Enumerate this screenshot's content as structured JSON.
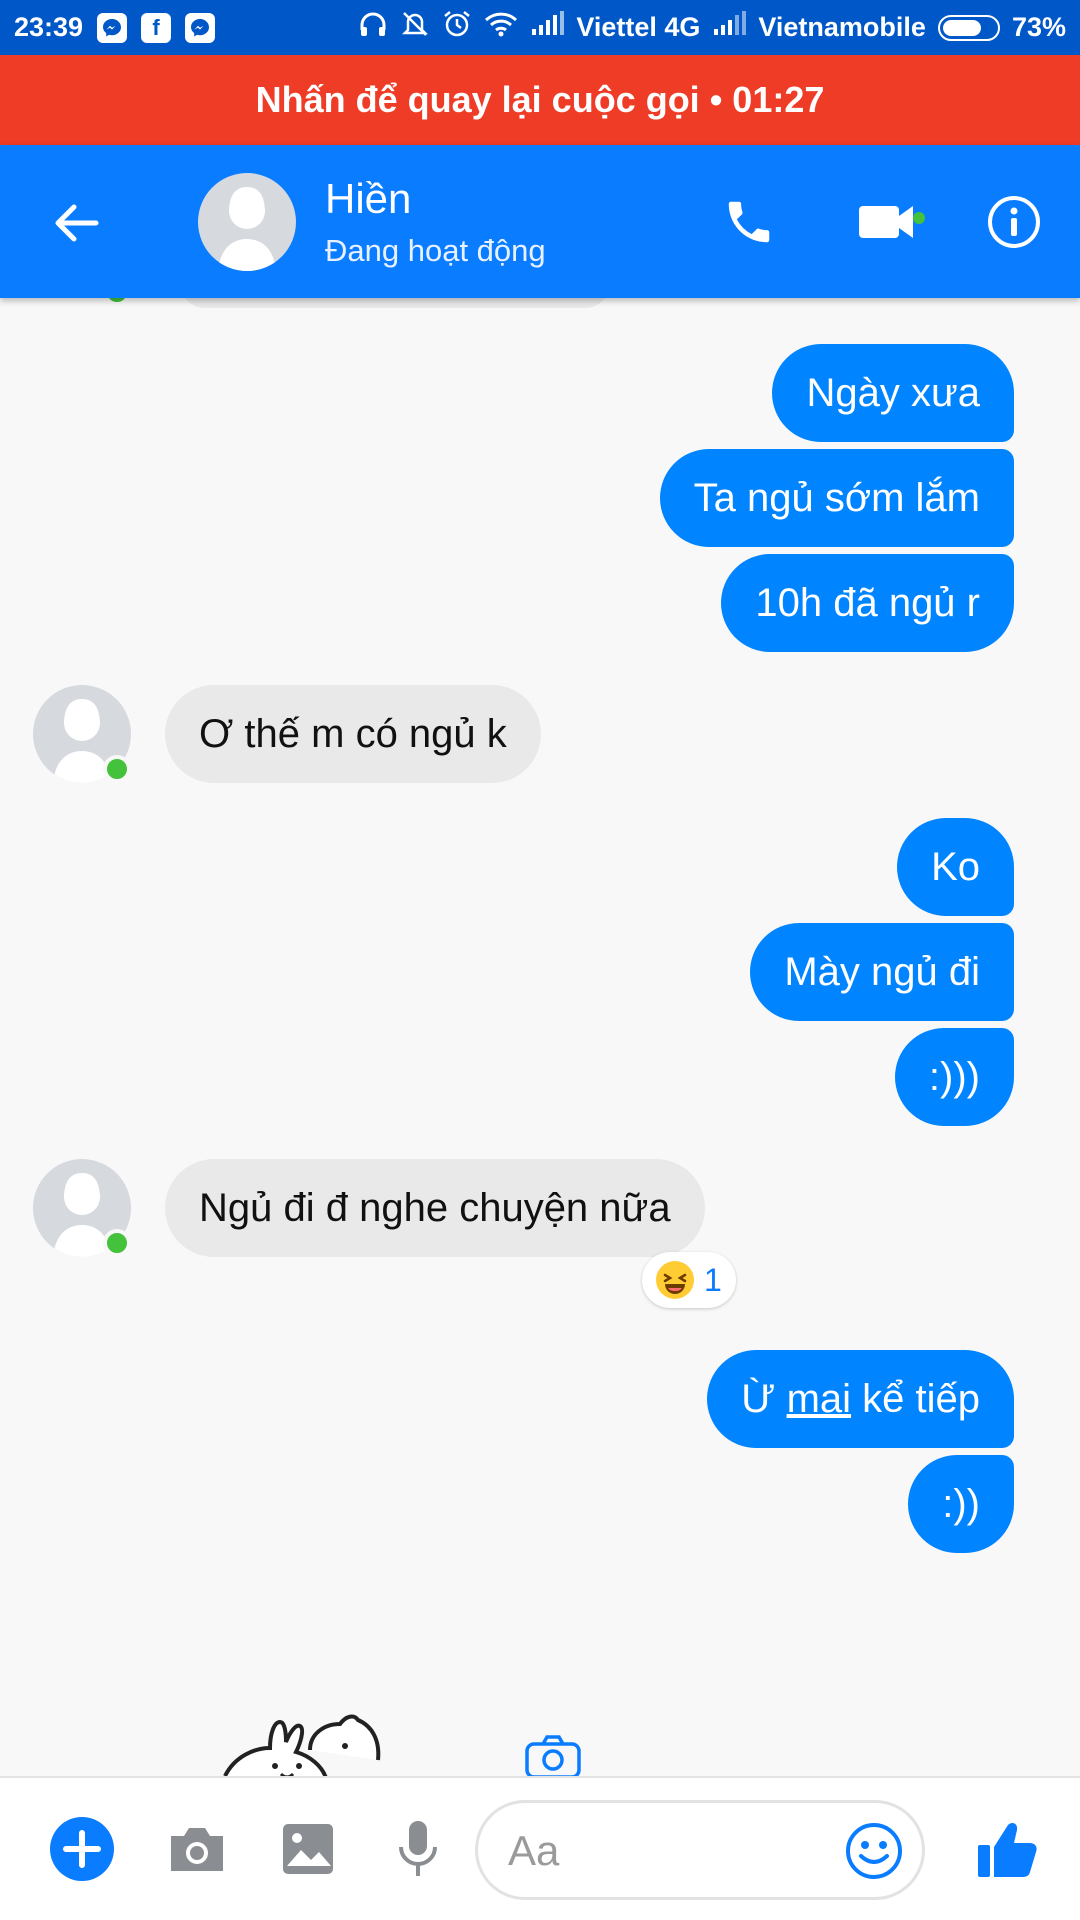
{
  "status_bar": {
    "time": "23:39",
    "apps": [
      "messenger-icon",
      "facebook-icon",
      "messenger-icon"
    ],
    "carrier1": "Viettel 4G",
    "carrier2": "Vietnamobile",
    "battery": "73%",
    "battery_level": 0.73
  },
  "call_banner": {
    "text": "Nhấn để quay lại cuộc gọi • 01:27"
  },
  "header": {
    "name": "Hiền",
    "status": "Đang hoạt động",
    "accent": "#0a7cff"
  },
  "messages": [
    {
      "dir": "out",
      "text": "Ngày xưa"
    },
    {
      "dir": "out",
      "text": "Ta ngủ sớm lắm"
    },
    {
      "dir": "out",
      "text": "10h đã ngủ r"
    },
    {
      "dir": "in",
      "text": "Ơ thế m có ngủ k"
    },
    {
      "dir": "out",
      "text": "Ko"
    },
    {
      "dir": "out",
      "text": "Mày ngủ đi"
    },
    {
      "dir": "out",
      "text": ":)))"
    },
    {
      "dir": "in",
      "text": "Ngủ đi đ nghe chuyện nữa",
      "reaction": {
        "emoji": "laughing-face-icon",
        "count": "1"
      }
    },
    {
      "dir": "out",
      "text_parts": [
        "Ừ ",
        "mai",
        " kể tiếp"
      ]
    },
    {
      "dir": "out",
      "text": ":))"
    }
  ],
  "composer": {
    "placeholder": "Aa"
  },
  "colors": {
    "outgoing": "#0084ff",
    "incoming": "#e9e9ea",
    "banner": "#ef3c27",
    "online": "#44c23b"
  }
}
